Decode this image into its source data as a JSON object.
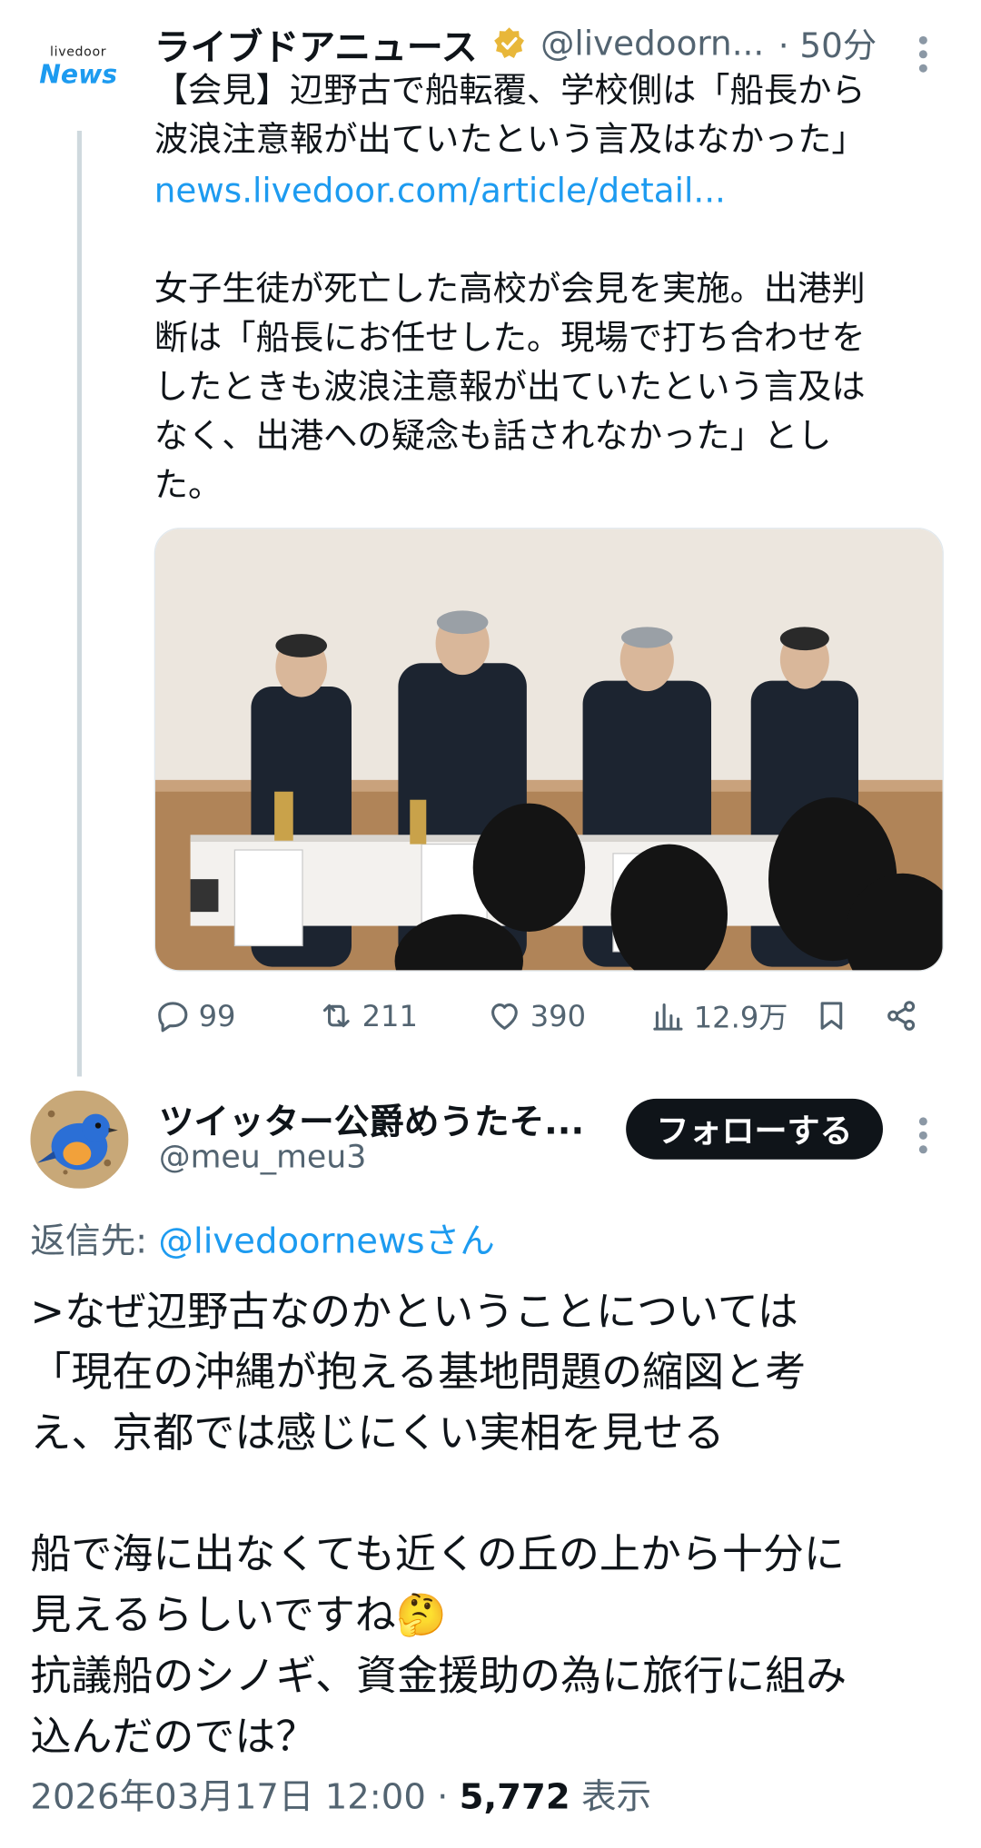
{
  "parent": {
    "logo_small": "livedoor",
    "logo_brand": "News",
    "display_name": "ライブドアニュース",
    "handle": "@livedoorn...",
    "time": "· 50分",
    "headline": "【会見】辺野古で船転覆、学校側は「船長から\n波浪注意報が出ていたという言及はなかった」",
    "link": "news.livedoor.com/article/detail...",
    "body": "女子生徒が死亡した高校が会見を実施。出港判\n断は「船長にお任せした。現場で打ち合わせを\nしたときも波浪注意報が出ていたという言及は\nなく、出港への疑念も話されなかった」とし\nた。",
    "actions": {
      "replies": "99",
      "retweets": "211",
      "likes": "390",
      "views": "12.9万"
    }
  },
  "reply": {
    "display_name": "ツイッター公爵めうたそ...",
    "handle": "@meu_meu3",
    "follow_label": "フォローする",
    "reply_prefix": "返信先: ",
    "reply_target": "@livedoornewsさん",
    "body": ">なぜ辺野古なのかということについては\n「現在の沖縄が抱える基地問題の縮図と考\nえ、京都では感じにくい実相を見せる\n\n船で海に出なくても近くの丘の上から十分に\n見えるらしいですね🤔\n抗議船のシノギ、資金援助の為に旅行に組み\n込んだのでは？",
    "timestamp": "2026年03月17日 12:00 · ",
    "views": "5,772",
    "views_label": " 表示"
  },
  "colors": {
    "accent": "#1d9bf0",
    "text": "#0f1419",
    "muted": "#536471",
    "verified": "#e8b73a"
  }
}
